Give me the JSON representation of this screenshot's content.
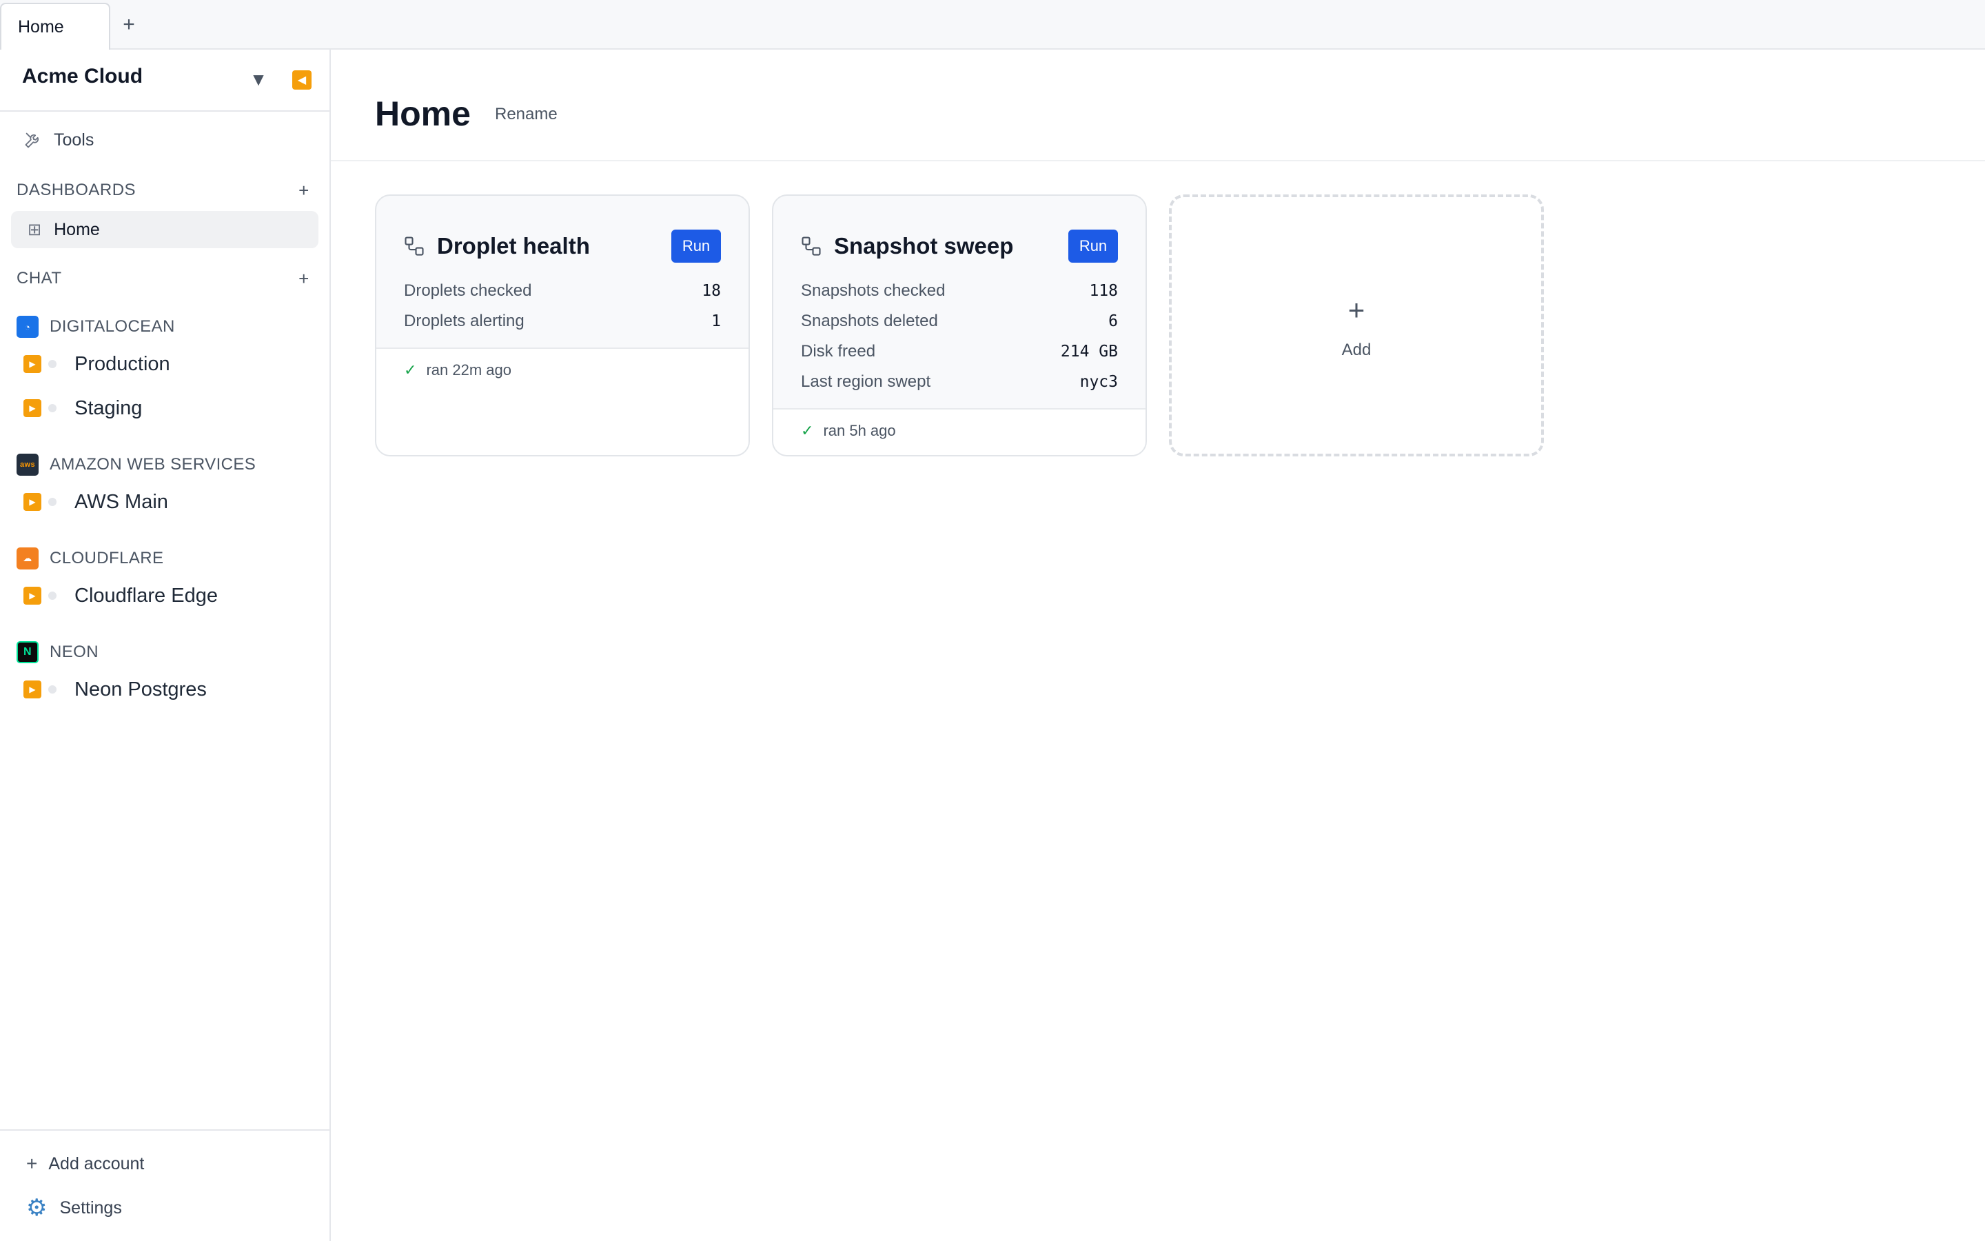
{
  "tabs": {
    "items": [
      {
        "label": "Home"
      }
    ],
    "add_label": "+"
  },
  "sidebar": {
    "org_name": "Acme Cloud",
    "tools_label": "Tools",
    "dashboards_header": "DASHBOARDS",
    "dashboards_add": "+",
    "dashboards": [
      {
        "label": "Home",
        "icon": "grid-icon"
      }
    ],
    "chat_header": "CHAT",
    "chat_add": "+",
    "providers": [
      {
        "name": "DIGITALOCEAN",
        "icon": "digitalocean-logo-icon",
        "color": "#1a73e8",
        "chats": [
          "Production",
          "Staging"
        ]
      },
      {
        "name": "AMAZON WEB SERVICES",
        "icon": "aws-logo-icon",
        "logo_text": "aws",
        "color": "#232f3e",
        "chats": [
          "AWS Main"
        ]
      },
      {
        "name": "CLOUDFLARE",
        "icon": "cloudflare-logo-icon",
        "color": "#f38020",
        "chats": [
          "Cloudflare Edge"
        ]
      },
      {
        "name": "NEON",
        "icon": "neon-logo-icon",
        "color": "#00e599",
        "chats": [
          "Neon Postgres"
        ]
      }
    ],
    "add_account_label": "Add account",
    "settings_label": "Settings"
  },
  "main": {
    "title": "Home",
    "rename_label": "Rename",
    "cards": [
      {
        "title": "Droplet health",
        "run_label": "Run",
        "stats": [
          {
            "label": "Droplets checked",
            "value": "18"
          },
          {
            "label": "Droplets alerting",
            "value": "1"
          }
        ],
        "status": "ran 22m ago"
      },
      {
        "title": "Snapshot sweep",
        "run_label": "Run",
        "stats": [
          {
            "label": "Snapshots checked",
            "value": "118"
          },
          {
            "label": "Snapshots deleted",
            "value": "6"
          },
          {
            "label": "Disk freed",
            "value": "214 GB"
          },
          {
            "label": "Last region swept",
            "value": "nyc3"
          }
        ],
        "status": "ran 5h ago"
      }
    ],
    "add_card_plus": "+",
    "add_card_label": "Add"
  },
  "colors": {
    "accent": "#1d5be6",
    "play": "#f59e0b",
    "success": "#16a34a"
  }
}
